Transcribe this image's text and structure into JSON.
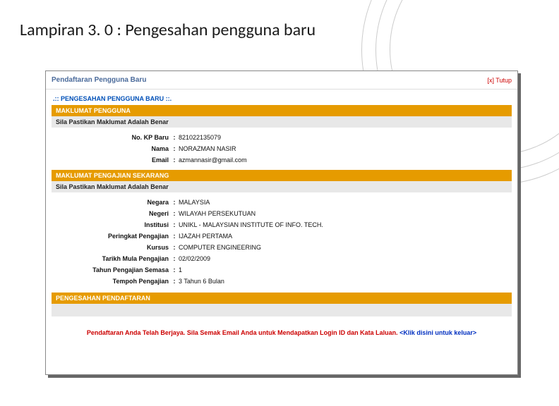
{
  "slide": {
    "title": "Lampiran 3. 0 : Pengesahan pengguna baru"
  },
  "window": {
    "title": "Pendaftaran Pengguna Baru",
    "close_label": "[x] Tutup",
    "subheading": ".:: PENGESAHAN PENGGUNA BARU ::."
  },
  "section_personal": {
    "header": "MAKLUMAT PENGGUNA",
    "subheader": "Sila Pastikan Maklumat Adalah Benar",
    "fields": [
      {
        "label": "No. KP Baru",
        "value": "821022135079"
      },
      {
        "label": "Nama",
        "value": "NORAZMAN NASIR"
      },
      {
        "label": "Email",
        "value": "azmannasir@gmail.com"
      }
    ]
  },
  "section_study": {
    "header": "MAKLUMAT PENGAJIAN SEKARANG",
    "subheader": "Sila Pastikan Maklumat Adalah Benar",
    "fields": [
      {
        "label": "Negara",
        "value": "MALAYSIA"
      },
      {
        "label": "Negeri",
        "value": "WILAYAH PERSEKUTUAN"
      },
      {
        "label": "Institusi",
        "value": "UNIKL - MALAYSIAN INSTITUTE OF INFO. TECH."
      },
      {
        "label": "Peringkat Pengajian",
        "value": "IJAZAH PERTAMA"
      },
      {
        "label": "Kursus",
        "value": "COMPUTER ENGINEERING"
      },
      {
        "label": "Tarikh Mula Pengajian",
        "value": "02/02/2009"
      },
      {
        "label": "Tahun Pengajian Semasa",
        "value": "1"
      },
      {
        "label": "Tempoh Pengajian",
        "value": "3 Tahun 6 Bulan"
      }
    ]
  },
  "confirm_bar": "PENGESAHAN PENDAFTARAN",
  "success": {
    "text": "Pendaftaran Anda Telah Berjaya. Sila Semak Email Anda untuk Mendapatkan Login ID dan Kata Laluan. ",
    "link": "<Klik disini untuk keluar>"
  }
}
